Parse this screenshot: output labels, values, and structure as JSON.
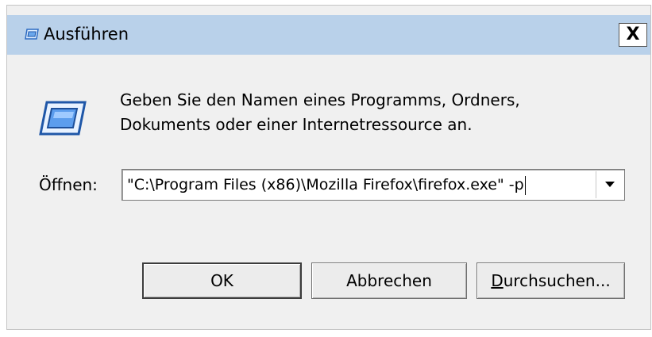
{
  "dialog": {
    "title": "Ausführen",
    "close_label": "X",
    "description_line1": "Geben Sie den Namen eines Programms, Ordners,",
    "description_line2": "Dokuments oder einer Internetressource an.",
    "open_label": "Öffnen:",
    "command_value": "\"C:\\Program Files (x86)\\Mozilla Firefox\\firefox.exe\" -p",
    "buttons": {
      "ok": "OK",
      "cancel": "Abbrechen",
      "browse": "Durchsuchen..."
    }
  },
  "icons": {
    "title": "run-icon",
    "main": "run-icon",
    "dropdown": "chevron-down-icon"
  },
  "colors": {
    "titlebar": "#b9d1ea",
    "window": "#f0f0f0",
    "icon_blue": "#3a7bd5"
  }
}
